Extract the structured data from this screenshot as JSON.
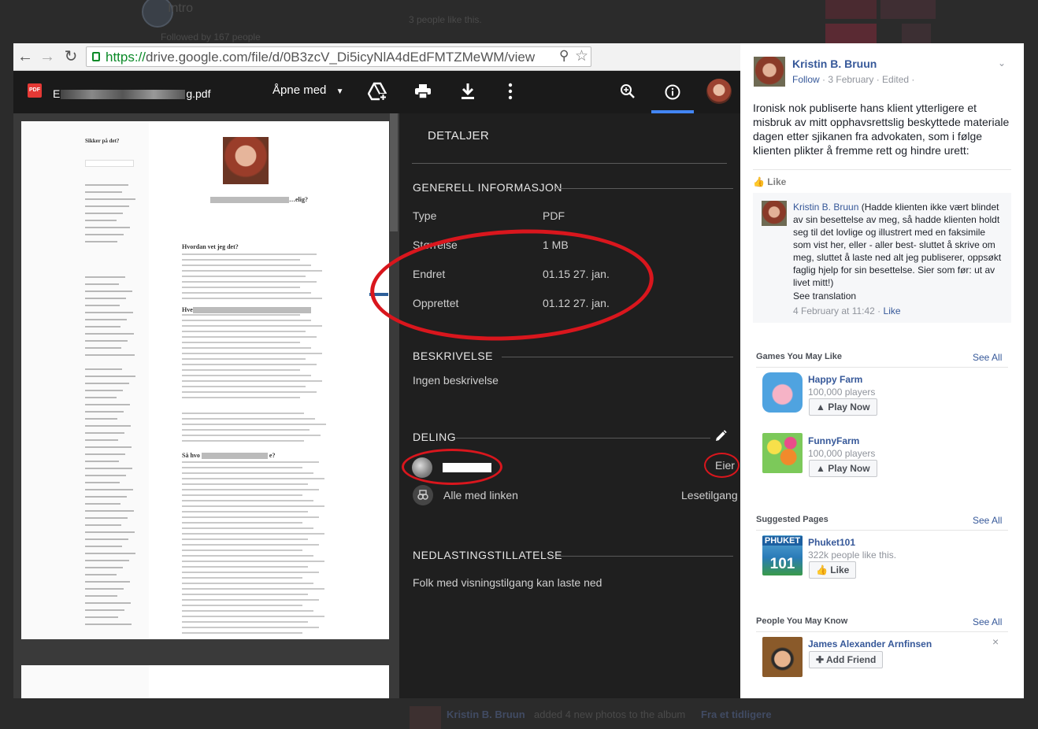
{
  "background": {
    "intro": "Intro",
    "followed_by": "Followed by 167 people",
    "likes": "3 people like this.",
    "footer_name": "Kristin B. Bruun",
    "footer_action": "added 4 new photos to the album",
    "footer_album": "Fra et tidligere"
  },
  "browser": {
    "url_scheme": "https://",
    "url_rest": "drive.google.com/file/d/0B3zcV_Di5icyNlA4dEdFMTZMeWM/view"
  },
  "viewer": {
    "pdf_badge": "PDF",
    "file_name_start": "E",
    "file_name_end": "g.pdf",
    "open_with": "Åpne med"
  },
  "document": {
    "sidebar_title": "Sikker på det?",
    "heading_main": "…elig?",
    "heading_1": "Hvordan vet jeg det?",
    "heading_2": "Hve",
    "heading_3": "Så hvo",
    "heading_3_end": "e?"
  },
  "details": {
    "title": "DETALJER",
    "general_heading": "GENERELL INFORMASJON",
    "rows": [
      {
        "label": "Type",
        "value": "PDF"
      },
      {
        "label": "Størrelse",
        "value": "1 MB"
      },
      {
        "label": "Endret",
        "value": "01.15 27. jan."
      },
      {
        "label": "Opprettet",
        "value": "01.12 27. jan."
      }
    ],
    "description_heading": "BESKRIVELSE",
    "description": "Ingen beskrivelse",
    "sharing_heading": "DELING",
    "owner_role": "Eier",
    "link_label": "Alle med linken",
    "link_access": "Lesetilgang",
    "download_heading": "NEDLASTINGSTILLATELSE",
    "download_text": "Folk med visningstilgang kan laste ned"
  },
  "facebook": {
    "post": {
      "author": "Kristin B. Bruun",
      "follow": "Follow",
      "meta": " · 3 February · Edited ·",
      "text": "Ironisk nok publiserte hans klient ytterligere et misbruk av mitt opphavsrettslig beskyttede materiale dagen etter sjikanen fra advokaten, som i følge klienten plikter å fremme rett og hindre urett:",
      "like": "Like"
    },
    "comment": {
      "author": "Kristin B. Bruun",
      "text": " (Hadde klienten ikke vært blindet av sin besettelse av meg, så hadde klienten holdt seg til det lovlige og illustrert med en faksimile som vist her, eller - aller best- sluttet å skrive om meg, sluttet å laste ned alt jeg publiserer, oppsøkt faglig hjelp for sin besettelse. Sier som før: ut av livet mitt!)",
      "translation": "See translation",
      "time": "4 February at 11:42 · ",
      "like": "Like"
    },
    "games": {
      "heading": "Games You May Like",
      "see_all": "See All",
      "items": [
        {
          "name": "Happy Farm",
          "players": "100,000 players",
          "button": "Play Now"
        },
        {
          "name": "FunnyFarm",
          "players": "100,000 players",
          "button": "Play Now"
        }
      ]
    },
    "pages": {
      "heading": "Suggested Pages",
      "see_all": "See All",
      "name": "Phuket101",
      "likes": "322k people like this.",
      "button": "Like",
      "thumb_top": "PHUKET",
      "thumb_bottom": "101"
    },
    "people": {
      "heading": "People You May Know",
      "see_all": "See All",
      "name": "James Alexander Arnfinsen",
      "button": "Add Friend",
      "close": "×"
    }
  }
}
